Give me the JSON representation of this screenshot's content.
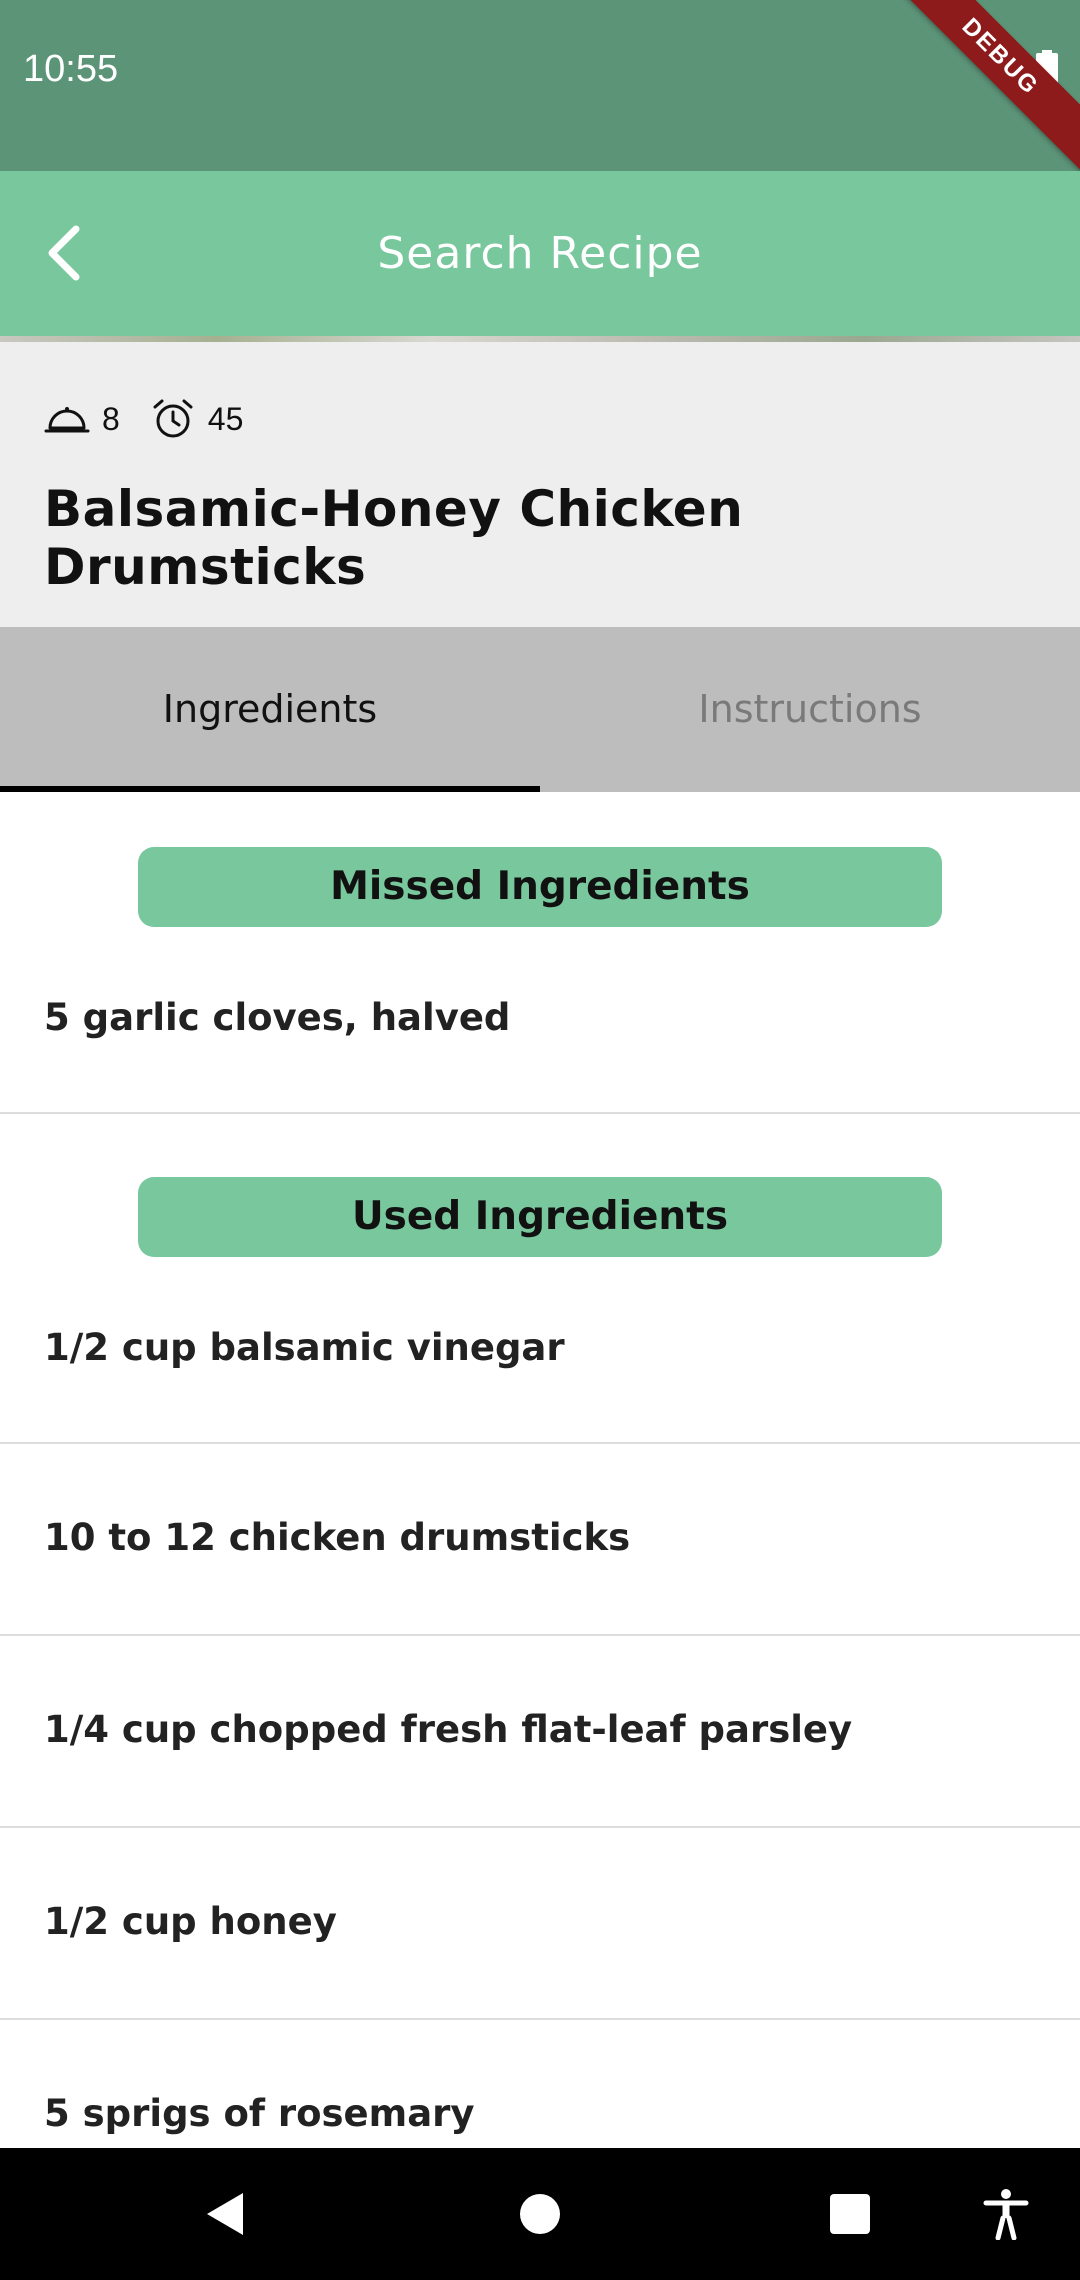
{
  "status_bar": {
    "time": "10:55",
    "debug_label": "DEBUG"
  },
  "app_bar": {
    "title": "Search Recipe",
    "back_icon": "chevron-left-icon"
  },
  "recipe": {
    "servings": "8",
    "servings_icon": "serving-dish-icon",
    "time": "45",
    "time_icon": "alarm-clock-icon",
    "title": "Balsamic-Honey Chicken Drumsticks"
  },
  "tabs": [
    {
      "label": "Ingredients",
      "selected": true
    },
    {
      "label": "Instructions",
      "selected": false
    }
  ],
  "missed": {
    "heading": "Missed Ingredients",
    "items": [
      "5 garlic cloves, halved"
    ]
  },
  "used": {
    "heading": "Used Ingredients",
    "items": [
      "1/2 cup balsamic vinegar",
      "10 to 12 chicken drumsticks",
      "1/4 cup chopped fresh flat-leaf parsley",
      "1/2 cup honey",
      "5 sprigs of rosemary"
    ]
  },
  "colors": {
    "status_bar": "#5c9478",
    "accent": "#78c79d",
    "header_bg": "#eeeeee",
    "tab_bg": "#bdbdbd"
  },
  "nav_bar": {
    "icons": [
      "back-triangle-icon",
      "home-circle-icon",
      "recents-square-icon",
      "accessibility-icon"
    ]
  }
}
